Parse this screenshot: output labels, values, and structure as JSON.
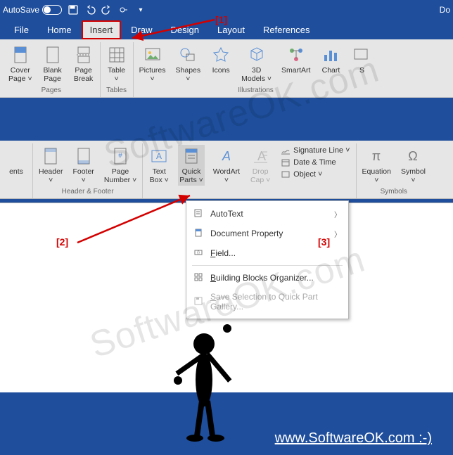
{
  "titlebar": {
    "autosave_label": "AutoSave",
    "autosave_state": "Off",
    "doc_title": "Do"
  },
  "tabs": [
    "File",
    "Home",
    "Insert",
    "Draw",
    "Design",
    "Layout",
    "References"
  ],
  "active_tab_index": 2,
  "ribbon1": {
    "groups": [
      {
        "label": "Pages",
        "items": [
          {
            "label": "Cover\nPage ˅",
            "name": "cover-page"
          },
          {
            "label": "Blank\nPage",
            "name": "blank-page"
          },
          {
            "label": "Page\nBreak",
            "name": "page-break"
          }
        ]
      },
      {
        "label": "Tables",
        "items": [
          {
            "label": "Table\n˅",
            "name": "table"
          }
        ]
      },
      {
        "label": "Illustrations",
        "items": [
          {
            "label": "Pictures\n˅",
            "name": "pictures"
          },
          {
            "label": "Shapes\n˅",
            "name": "shapes"
          },
          {
            "label": "Icons",
            "name": "icons"
          },
          {
            "label": "3D\nModels ˅",
            "name": "3d-models"
          },
          {
            "label": "SmartArt",
            "name": "smartart"
          },
          {
            "label": "Chart",
            "name": "chart"
          },
          {
            "label": "S",
            "name": "screenshot-partial"
          }
        ]
      }
    ]
  },
  "ribbon2": {
    "groups": [
      {
        "label": "",
        "items": [
          {
            "label": "ents",
            "name": "comments-partial"
          }
        ]
      },
      {
        "label": "Header & Footer",
        "items": [
          {
            "label": "Header\n˅",
            "name": "header"
          },
          {
            "label": "Footer\n˅",
            "name": "footer"
          },
          {
            "label": "Page\nNumber ˅",
            "name": "page-number"
          }
        ]
      },
      {
        "label": "",
        "items": [
          {
            "label": "Text\nBox ˅",
            "name": "text-box"
          },
          {
            "label": "Quick\nParts ˅",
            "name": "quick-parts",
            "pressed": true
          },
          {
            "label": "WordArt\n˅",
            "name": "wordart"
          },
          {
            "label": "Drop\nCap ˅",
            "name": "drop-cap",
            "faded": true
          }
        ],
        "stack": [
          {
            "label": "Signature Line  ˅",
            "name": "signature-line"
          },
          {
            "label": "Date & Time",
            "name": "date-time"
          },
          {
            "label": "Object  ˅",
            "name": "object"
          }
        ]
      },
      {
        "label": "Symbols",
        "items": [
          {
            "label": "Equation\n˅",
            "name": "equation"
          },
          {
            "label": "Symbol\n˅",
            "name": "symbol"
          }
        ]
      }
    ]
  },
  "menu": {
    "items": [
      {
        "label": "AutoText",
        "has_arrow": true,
        "name": "autotext"
      },
      {
        "label": "Document Property",
        "has_arrow": true,
        "name": "document-property"
      },
      {
        "label": "Field...",
        "name": "field",
        "underline": 0
      },
      {
        "sep": true
      },
      {
        "label": "Building Blocks Organizer...",
        "name": "building-blocks-organizer",
        "underline": 0
      },
      {
        "label": "Save Selection to Quick Part Gallery...",
        "name": "save-selection",
        "disabled": true,
        "underline": 0
      }
    ]
  },
  "annotations": {
    "a1": "[1]",
    "a2": "[2]",
    "a3": "[3]"
  },
  "footer": "www.SoftwareOK.com  :-)",
  "watermark": "SoftwareOK.com"
}
